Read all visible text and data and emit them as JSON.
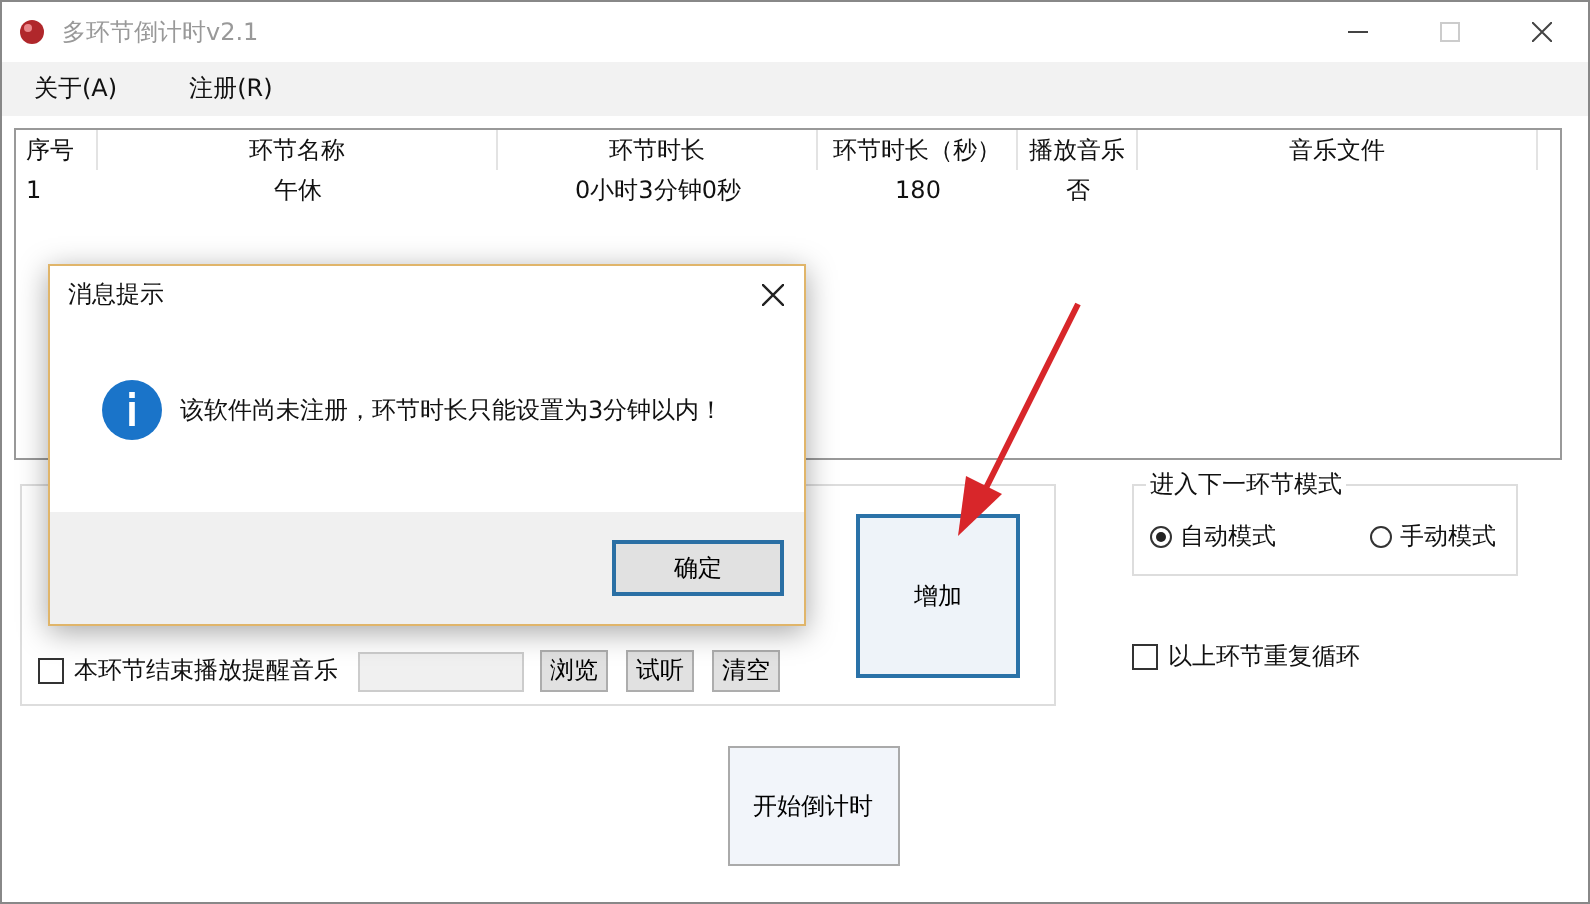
{
  "window": {
    "title": "多环节倒计时v2.1"
  },
  "menu": [
    {
      "label": "关于(A)"
    },
    {
      "label": "注册(R)"
    }
  ],
  "table": {
    "columns": [
      "序号",
      "环节名称",
      "环节时长",
      "环节时长（秒）",
      "播放音乐",
      "音乐文件"
    ],
    "rows": [
      {
        "cells": [
          "1",
          "午休",
          "0小时3分钟0秒",
          "180",
          "否"
        ]
      }
    ]
  },
  "segment_group": {
    "music_checkbox": {
      "label": "本环节结束播放提醒音乐",
      "checked": false
    },
    "buttons": [
      "浏览",
      "试听",
      "清空"
    ]
  },
  "add_button": "增加",
  "mode_group": {
    "title": "进入下一环节模式",
    "options": [
      {
        "label": "自动模式",
        "selected": true
      },
      {
        "label": "手动模式",
        "selected": false
      }
    ]
  },
  "repeat_checkbox": {
    "label": "以上环节重复循环",
    "checked": false
  },
  "start_button": "开始倒计时",
  "dialog": {
    "title": "消息提示",
    "message": "该软件尚未注册，环节时长只能设置为3分钟以内！",
    "button": "确定"
  }
}
